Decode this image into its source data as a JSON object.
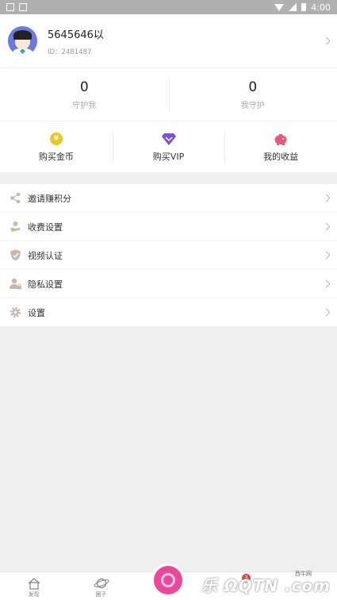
{
  "statusbar": {
    "time": "4:00"
  },
  "profile": {
    "username": "5645646以",
    "id_text": "ID：2481487"
  },
  "stats": [
    {
      "value": "0",
      "label": "守护我"
    },
    {
      "value": "0",
      "label": "我守护"
    }
  ],
  "actions": [
    {
      "label": "购买金币",
      "icon": "coin-icon",
      "color": "#f5c41a"
    },
    {
      "label": "购买VIP",
      "icon": "diamond-icon",
      "color": "#7b4fd6"
    },
    {
      "label": "我的收益",
      "icon": "piggy-bank-icon",
      "color": "#f0557a"
    }
  ],
  "menu": [
    {
      "label": "邀请赚积分",
      "icon": "share-icon"
    },
    {
      "label": "收费设置",
      "icon": "hand-coin-icon"
    },
    {
      "label": "视频认证",
      "icon": "shield-check-icon"
    },
    {
      "label": "隐私设置",
      "icon": "user-lock-icon"
    },
    {
      "label": "设置",
      "icon": "gear-icon"
    }
  ],
  "tabbar": {
    "tabs": [
      {
        "label": "发现",
        "icon": "home-icon"
      },
      {
        "label": "圈子",
        "icon": "planet-icon"
      }
    ],
    "badge": "3"
  },
  "watermark": {
    "small": "西牛网",
    "large": "乐 ΩQTN .com"
  },
  "colors": {
    "accent": "#f0469a",
    "icon_gray": "#c9b8a8"
  }
}
